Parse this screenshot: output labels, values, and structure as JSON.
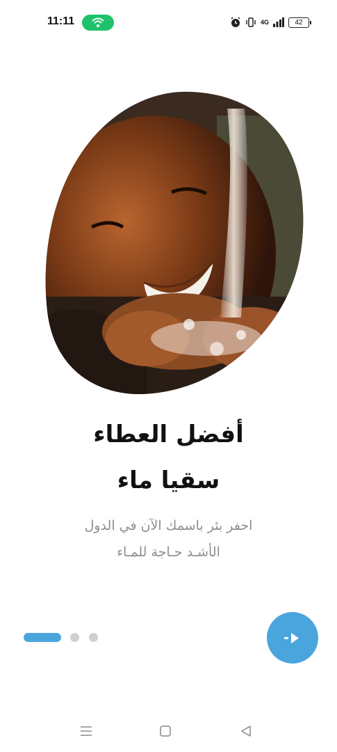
{
  "status_bar": {
    "time": "11:11",
    "network": "4G",
    "battery": "42",
    "wifi_color": "#1fc26b"
  },
  "onboarding": {
    "title_line1": "أفضل العطاء",
    "title_line2": "سقيا ماء",
    "description_line1": "احفر بئر باسمك الآن في الدول",
    "description_line2": "الأشـد حـاجة للمـاء",
    "accent_color": "#4aa5dd",
    "current_page": 1,
    "total_pages": 3
  },
  "nav_bar": {
    "icons": [
      "menu-icon",
      "home-icon",
      "back-icon"
    ]
  }
}
